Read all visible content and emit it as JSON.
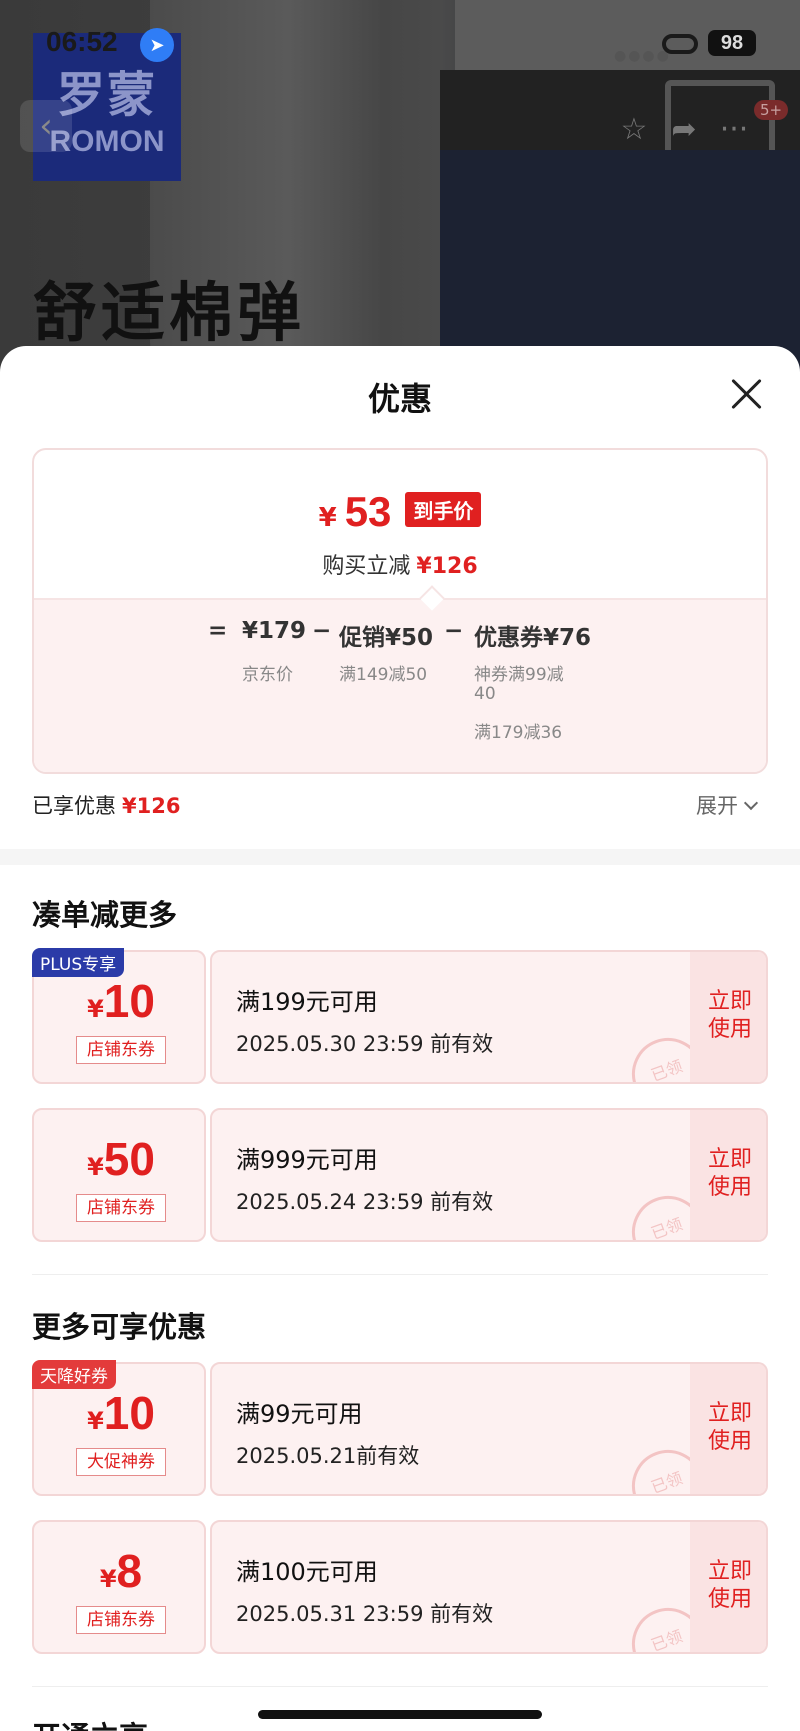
{
  "status": {
    "time": "06:52",
    "battery": "98"
  },
  "product": {
    "brand_logo_cn": "罗蒙",
    "brand_logo_en": "ROMON",
    "hero_text": "舒适棉弹",
    "message_badge": "5+"
  },
  "sheet": {
    "title": "优惠",
    "final_price": {
      "currency": "¥",
      "value": "53",
      "tag": "到手价"
    },
    "reduce": {
      "label": "购买立减",
      "amount": "¥126"
    },
    "formula": {
      "equals": "=",
      "jd_price": "¥179",
      "jd_price_label": "京东价",
      "minus1": "−",
      "promo": "促销¥50",
      "promo_sub": "满149减50",
      "minus2": "−",
      "coupon": "优惠券¥76",
      "coupon_sub1_line1": "神券满99减",
      "coupon_sub1_line2": "40",
      "coupon_sub2": "满179减36"
    },
    "enjoyed": {
      "label": "已享优惠",
      "amount": "¥126"
    },
    "expand_label": "展开"
  },
  "sections": [
    {
      "title": "凑单减更多"
    },
    {
      "title": "更多可享优惠"
    },
    {
      "title": "开通立享"
    }
  ],
  "coupons": [
    {
      "badge": "PLUS专享",
      "currency": "¥",
      "amount": "10",
      "type": "店铺东券",
      "condition": "满199元可用",
      "valid": "2025.05.30 23:59 前有效",
      "use_line1": "立即",
      "use_line2": "使用",
      "stamp": "已领"
    },
    {
      "badge": "",
      "currency": "¥",
      "amount": "50",
      "type": "店铺东券",
      "condition": "满999元可用",
      "valid": "2025.05.24 23:59 前有效",
      "use_line1": "立即",
      "use_line2": "使用",
      "stamp": "已领"
    },
    {
      "badge": "天降好券",
      "currency": "¥",
      "amount": "10",
      "type": "大促神券",
      "condition": "满99元可用",
      "valid": "2025.05.21前有效",
      "use_line1": "立即",
      "use_line2": "使用",
      "stamp": "已领"
    },
    {
      "badge": "",
      "currency": "¥",
      "amount": "8",
      "type": "店铺东券",
      "condition": "满100元可用",
      "valid": "2025.05.31 23:59 前有效",
      "use_line1": "立即",
      "use_line2": "使用",
      "stamp": "已领"
    }
  ],
  "colors": {
    "accent_red": "#e02020",
    "plus_blue": "#2b3ba8",
    "coupon_bg": "#fdf1f1"
  }
}
